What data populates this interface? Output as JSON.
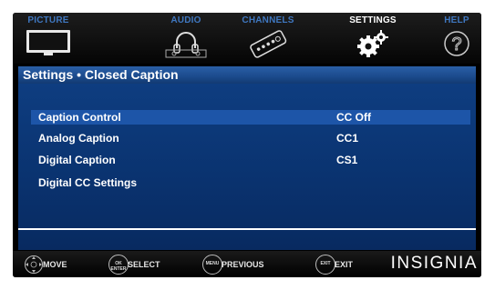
{
  "tabs": [
    {
      "label": "PICTURE",
      "icon": "tv-icon"
    },
    {
      "label": "AUDIO",
      "icon": "headphones-icon"
    },
    {
      "label": "CHANNELS",
      "icon": "remote-icon"
    },
    {
      "label": "SETTINGS",
      "icon": "gears-icon",
      "active": true
    },
    {
      "label": "HELP",
      "icon": "help-icon"
    }
  ],
  "title": "Settings • Closed Caption",
  "settings": [
    {
      "name": "Caption Control",
      "value": "CC Off",
      "selected": true
    },
    {
      "name": "Analog Caption",
      "value": "CC1"
    },
    {
      "name": "Digital Caption",
      "value": "CS1"
    },
    {
      "name": "Digital CC Settings",
      "value": ""
    }
  ],
  "hints": [
    {
      "key": "",
      "label": "MOVE"
    },
    {
      "key": "OK ENTER",
      "label": "SELECT"
    },
    {
      "key": "MENU",
      "label": "PREVIOUS"
    },
    {
      "key": "EXIT",
      "label": "EXIT"
    }
  ],
  "brand": "INSIGNIA",
  "colors": {
    "tab_label": "#3f77c0",
    "panel": "#0a3370",
    "selected_row": "#1d55a8"
  }
}
